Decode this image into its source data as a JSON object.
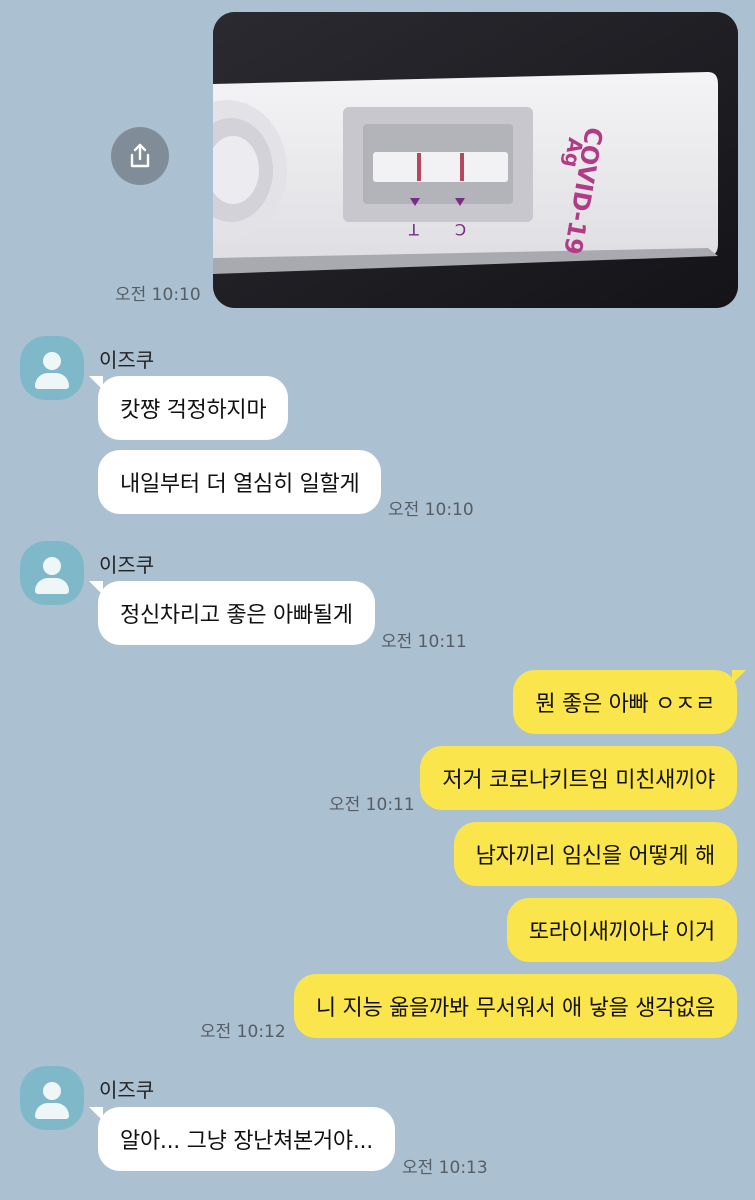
{
  "share_button": {
    "icon": "share-icon"
  },
  "photo": {
    "alt": "COVID-19 Ag antigen test cassette with two lines",
    "brand_text_line1": "COVID-19",
    "brand_text_line2": "Ag",
    "marker_c": "C",
    "marker_t": "T"
  },
  "times": {
    "t1": "오전 10:10",
    "t2": "오전 10:10",
    "t3": "오전 10:11",
    "t4": "오전 10:11",
    "t5": "오전 10:12",
    "t6": "오전 10:13"
  },
  "groups": [
    {
      "sender": "이즈쿠",
      "messages": [
        "캇쨩 걱정하지마",
        "내일부터 더 열심히 일할게"
      ]
    },
    {
      "sender": "이즈쿠",
      "messages": [
        "정신차리고 좋은 아빠될게"
      ]
    },
    {
      "sender": "me",
      "messages": [
        "뭔 좋은 아빠 ㅇㅈㄹ",
        "저거 코로나키트임 미친새끼야",
        "남자끼리 임신을 어떻게 해",
        "또라이새끼아냐 이거",
        "니 지능 옮을까봐 무서워서 애 낳을 생각없음"
      ]
    },
    {
      "sender": "이즈쿠",
      "messages": [
        "알아... 그냥 장난쳐본거야..."
      ]
    }
  ]
}
